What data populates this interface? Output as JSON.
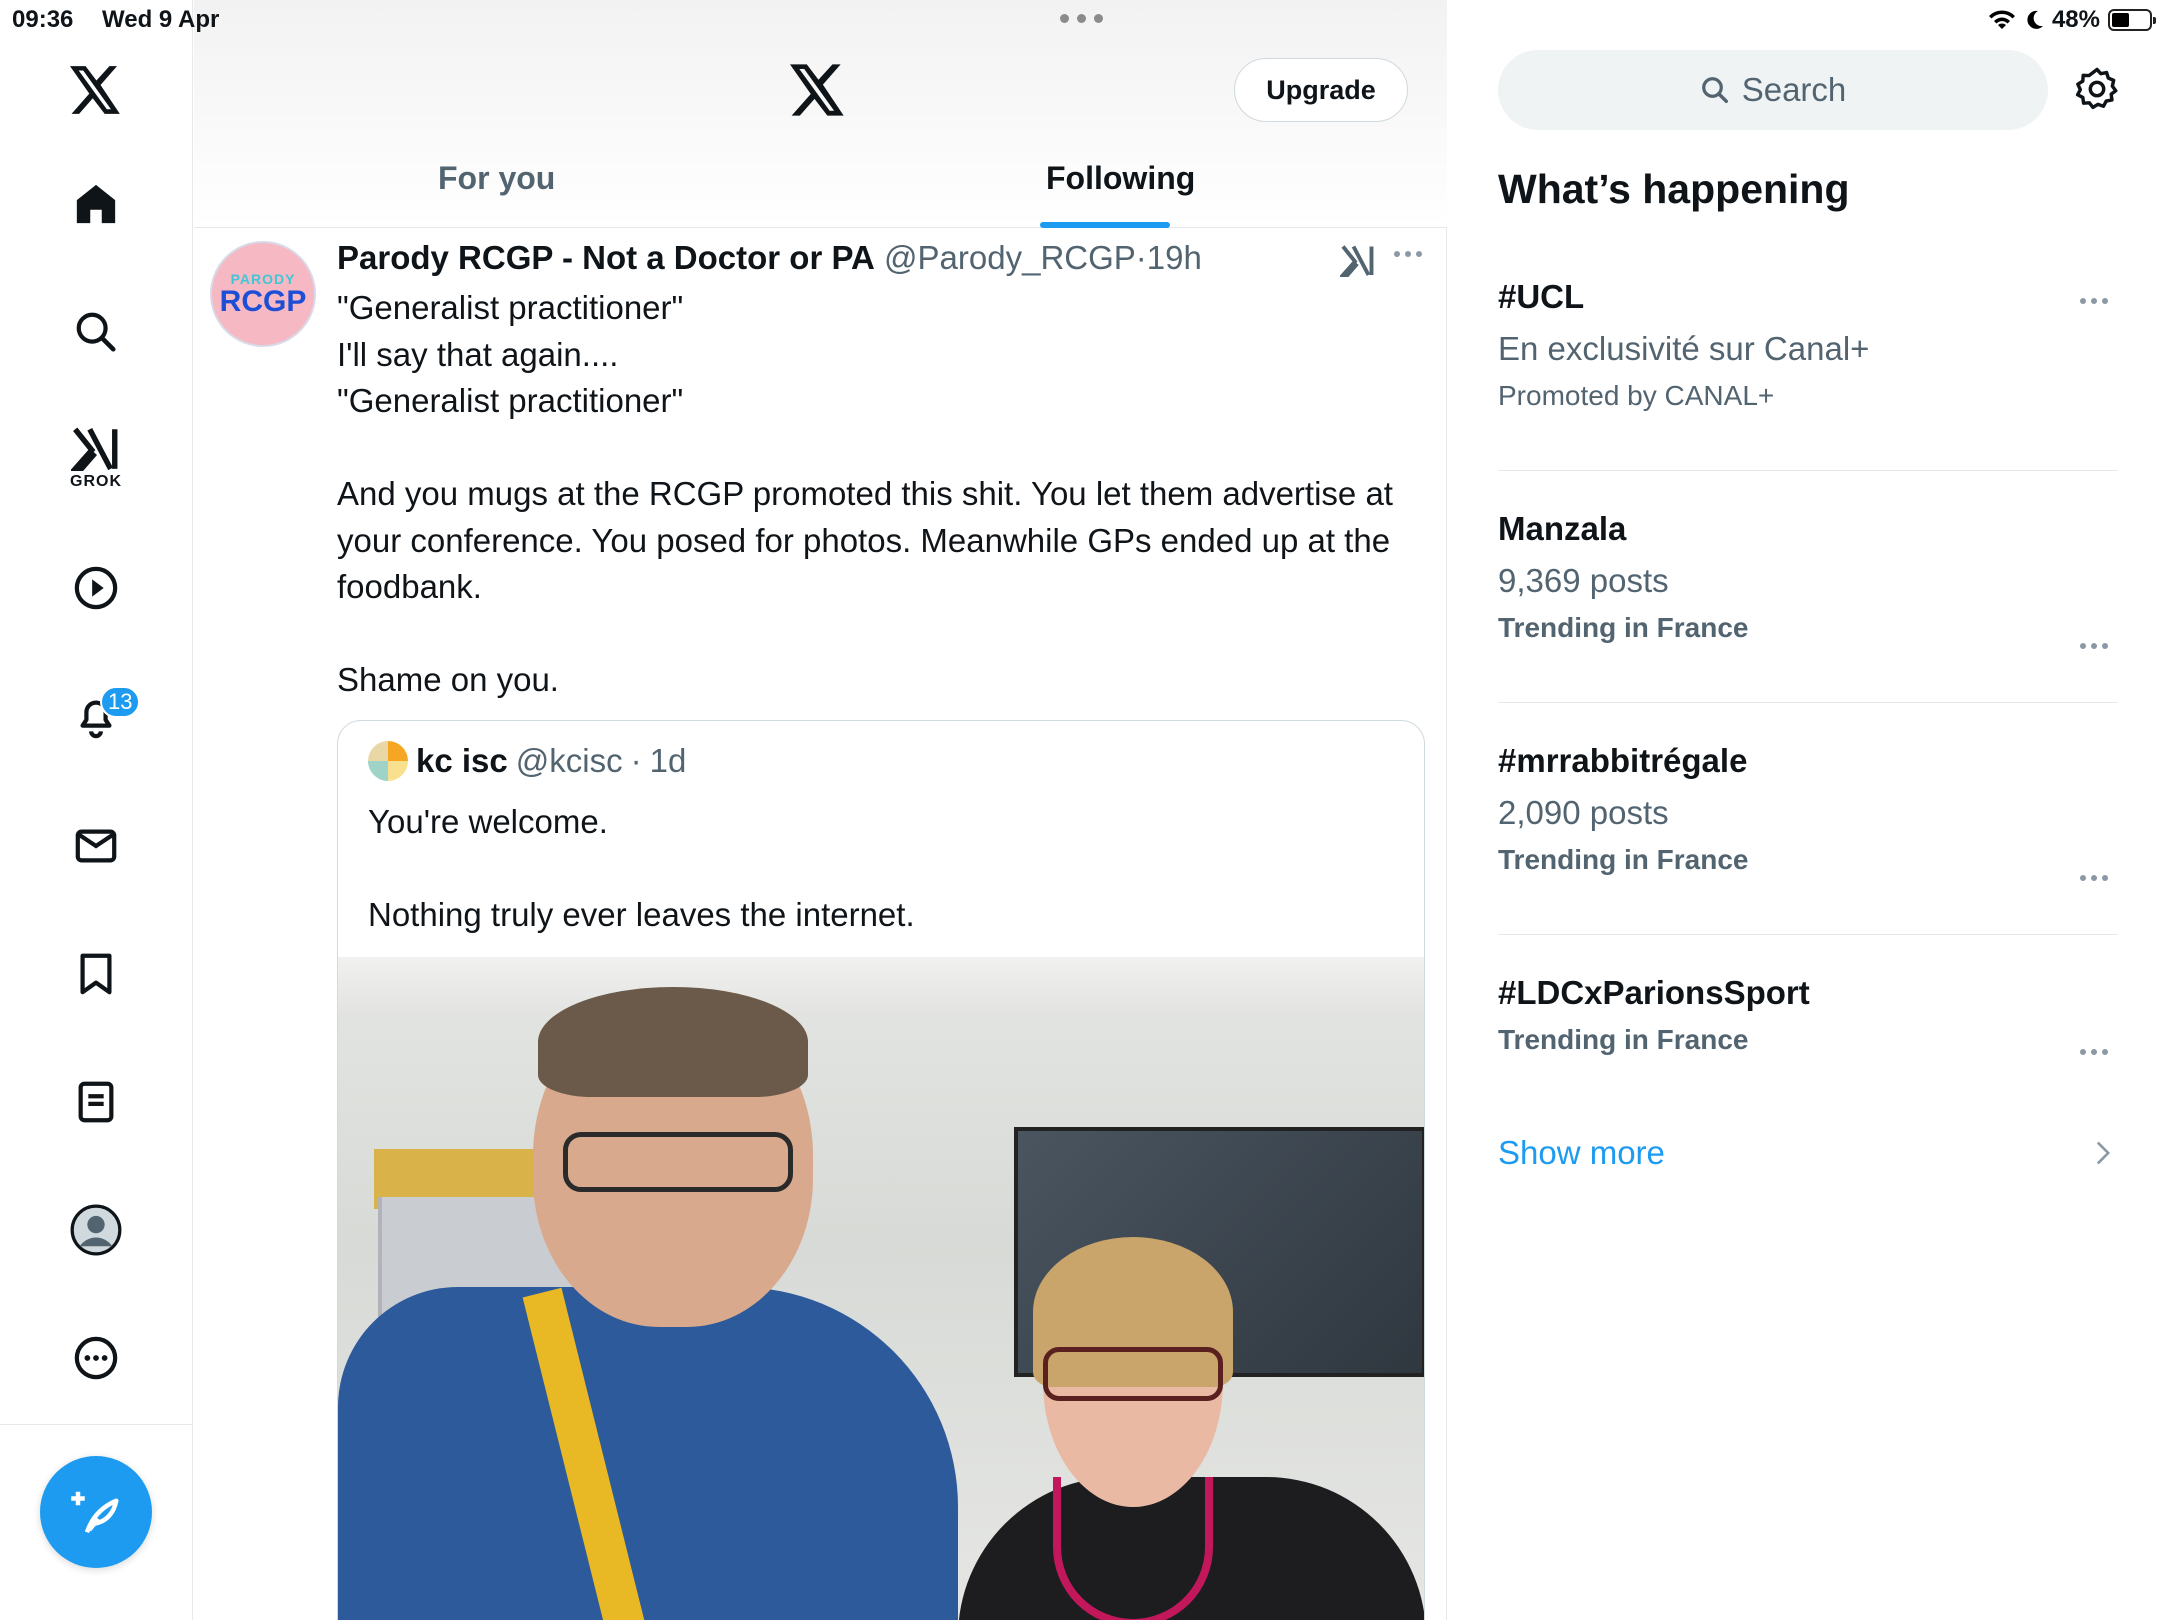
{
  "status_bar": {
    "time": "09:36",
    "date": "Wed 9 Apr",
    "battery": "48%",
    "battery_level": 0.48
  },
  "nav": {
    "grok_label": "GROK",
    "notifications_badge": "13",
    "items": [
      "x-logo-icon",
      "home-icon",
      "search-icon",
      "grok-icon",
      "video-icon",
      "bell-icon",
      "mail-icon",
      "bookmark-icon",
      "list-icon",
      "profile-icon",
      "more-icon"
    ]
  },
  "header": {
    "upgrade_label": "Upgrade",
    "tabs": [
      {
        "label": "For you",
        "active": false
      },
      {
        "label": "Following",
        "active": true
      }
    ]
  },
  "post": {
    "avatar_top": "PARODY",
    "avatar_main": "RCGP",
    "display_name": "Parody RCGP - Not a Doctor or PA",
    "handle": "@Parody_RCGP",
    "separator": "·",
    "time": "19h",
    "lines": [
      "\"Generalist practitioner\"",
      "I'll say that again....",
      "\"Generalist practitioner\"",
      "",
      "And you mugs at the RCGP promoted this shit. You let them advertise at your conference. You posed for photos. Meanwhile GPs ended up at the foodbank.",
      "",
      "Shame on you."
    ],
    "quote": {
      "display_name": "kc isc",
      "handle": "@kcisc",
      "separator": "·",
      "time": "1d",
      "lines": [
        "You're welcome.",
        "",
        "Nothing truly ever leaves the internet."
      ]
    }
  },
  "sidebar": {
    "search_placeholder": "Search",
    "section_title": "What’s happening",
    "trends": [
      {
        "title": "#UCL",
        "subtitle": "En exclusivité sur Canal+",
        "meta": "Promoted by CANAL+"
      },
      {
        "title": "Manzala",
        "subtitle": "9,369 posts",
        "meta": "Trending in France"
      },
      {
        "title": "#mrrabbitrégale",
        "subtitle": "2,090 posts",
        "meta": "Trending in France"
      },
      {
        "title": "#LDCxParionsSport",
        "subtitle": "",
        "meta": "Trending in France"
      }
    ],
    "show_more": "Show more"
  },
  "colors": {
    "accent": "#1d9bf0",
    "text": "#0f1419",
    "muted": "#536471",
    "border": "#e6e9ea"
  }
}
